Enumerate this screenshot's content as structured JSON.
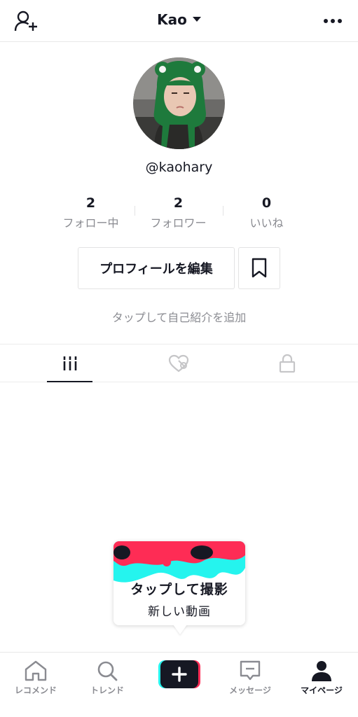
{
  "header": {
    "username": "Kao"
  },
  "profile": {
    "handle": "@kaohary",
    "bio_placeholder": "タップして自己紹介を追加"
  },
  "stats": [
    {
      "value": "2",
      "label": "フォロー中"
    },
    {
      "value": "2",
      "label": "フォロワー"
    },
    {
      "value": "0",
      "label": "いいね"
    }
  ],
  "actions": {
    "edit_profile": "プロフィールを編集"
  },
  "tooltip": {
    "line1": "タップして撮影",
    "line2": "新しい動画"
  },
  "nav": {
    "home": "レコメンド",
    "discover": "トレンド",
    "inbox": "メッセージ",
    "me": "マイページ"
  },
  "colors": {
    "accent_red": "#fe2c55",
    "accent_cyan": "#25f4ee",
    "text": "#161823",
    "muted": "#8a8b91"
  },
  "icons": [
    "add-user-icon",
    "caret-down-icon",
    "more-icon",
    "bookmark-icon",
    "grid-icon",
    "liked-icon",
    "lock-icon",
    "home-icon",
    "search-icon",
    "plus-icon",
    "inbox-icon",
    "profile-icon"
  ]
}
